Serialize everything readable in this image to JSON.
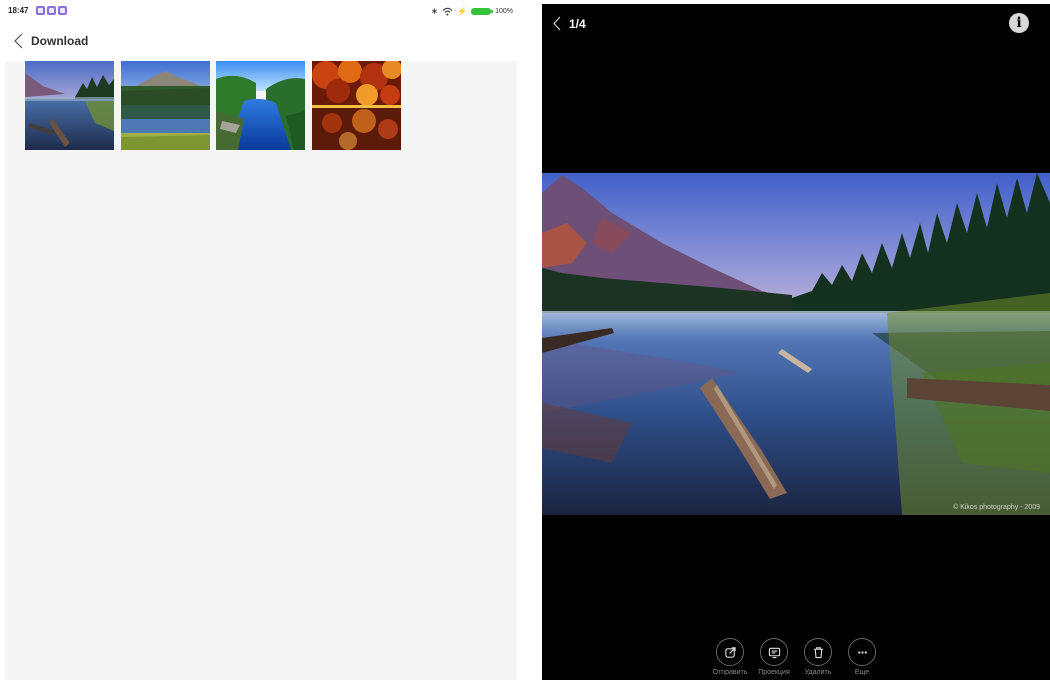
{
  "status_bar": {
    "time": "18:47",
    "notification_icons": [
      "app-icon",
      "app-icon",
      "app-icon"
    ],
    "battery_percent": "100%",
    "accent": "#8a6fe0",
    "battery_color": "#36c23d"
  },
  "gallery": {
    "title": "Download",
    "thumbnails": [
      {
        "name": "mountain-lake-logs"
      },
      {
        "name": "mountain-lake-reflection"
      },
      {
        "name": "blue-river-forest"
      },
      {
        "name": "autumn-forest-lake"
      }
    ]
  },
  "viewer": {
    "counter": "1/4",
    "watermark": "© Kikos photography - 2009",
    "actions": [
      {
        "label": "Отправить",
        "icon": "share-icon"
      },
      {
        "label": "Проекция",
        "icon": "projection-icon"
      },
      {
        "label": "Удалить",
        "icon": "trash-icon"
      },
      {
        "label": "Еще",
        "icon": "more-icon"
      }
    ]
  }
}
